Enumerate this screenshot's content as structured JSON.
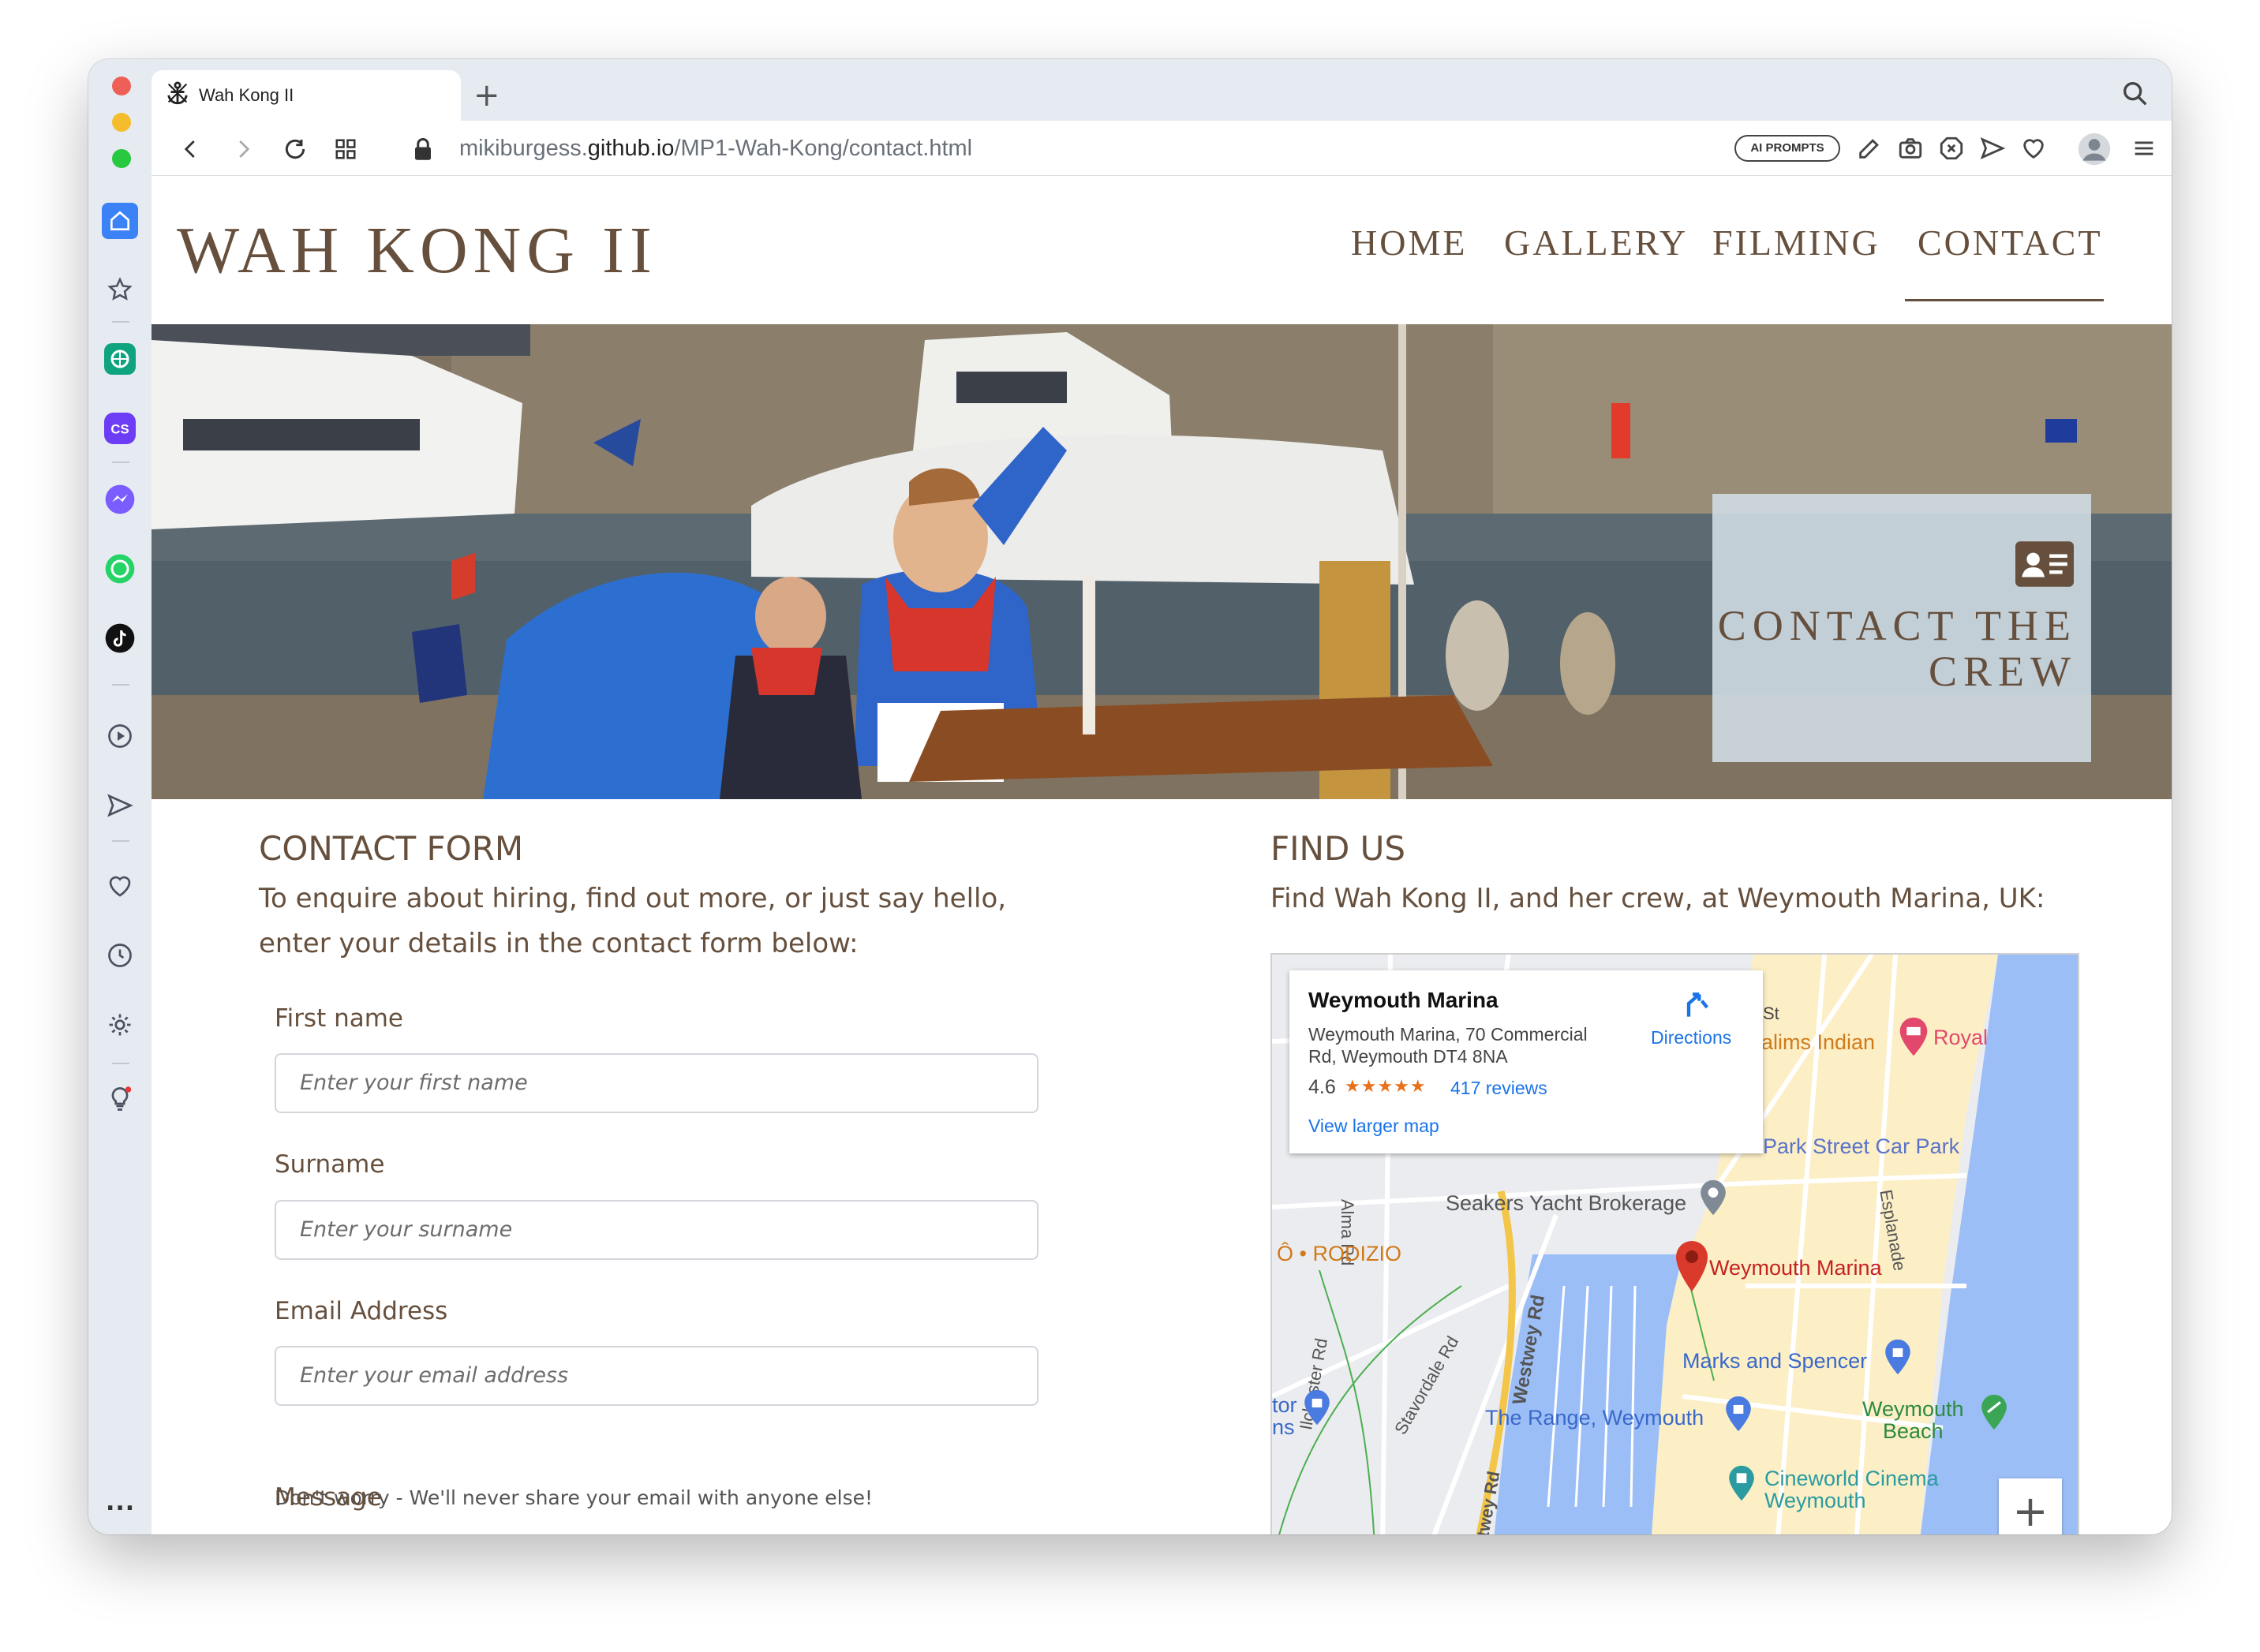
{
  "browser": {
    "tab_title": "Wah Kong II",
    "new_tab": "+",
    "url_prefix": "mikiburgess.",
    "url_domain": "github.io",
    "url_path": "/MP1-Wah-Kong/contact.html",
    "ai_prompts": "AI PROMPTS",
    "more": "..."
  },
  "site": {
    "brand": "WAH KONG II",
    "nav": [
      "HOME",
      "GALLERY",
      "FILMING",
      "CONTACT"
    ],
    "active_nav": "CONTACT",
    "hero_title_line1": "CONTACT THE",
    "hero_title_line2": "CREW"
  },
  "form": {
    "heading": "CONTACT FORM",
    "intro_line1": "To enquire about hiring, find out more, or just say hello,",
    "intro_line2": "enter your details in the contact form below:",
    "first_name_label": "First name",
    "first_name_placeholder": "Enter your first name",
    "surname_label": "Surname",
    "surname_placeholder": "Enter your surname",
    "email_label": "Email Address",
    "email_placeholder": "Enter your email address",
    "email_hint": "Don't worry - We'll never share your email with anyone else!",
    "message_label": "Message"
  },
  "find_us": {
    "heading": "FIND US",
    "intro": "Find Wah Kong II, and her crew, at Weymouth Marina, UK:",
    "map": {
      "place_name": "Weymouth Marina",
      "address_line1": "Weymouth Marina, 70 Commercial",
      "address_line2": "Rd, Weymouth DT4 8NA",
      "rating": "4.6",
      "stars": "★★★★★",
      "reviews": "417 reviews",
      "directions": "Directions",
      "view_larger": "View larger map",
      "zoom_in": "+",
      "labels": {
        "salims": "alims Indian",
        "royal": "Royal",
        "st": "St",
        "park_street": "Park Street Car Park",
        "seakers": "Seakers Yacht Brokerage",
        "alma": "Alma Rd",
        "rodizio": "Ô • RODIZIO",
        "westwey": "Westwey Rd",
        "westwey2": "estwey Rd",
        "esplanade": "Esplanade",
        "marina_pin": "Weymouth Marina",
        "marks": "Marks and Spencer",
        "ilchester": "Ilchester Rd",
        "stavordale": "Stavordale Rd",
        "range": "The Range, Weymouth",
        "beach_line1": "Weymouth",
        "beach_line2": "Beach",
        "cineworld_line1": "Cineworld Cinema",
        "cineworld_line2": "Weymouth",
        "tor": "tor",
        "ns": "ns"
      }
    }
  },
  "colors": {
    "brand_brown": "#66503d",
    "map_water": "#9cbef7",
    "map_sand": "#fcefc6",
    "link_blue": "#1a73e8"
  }
}
